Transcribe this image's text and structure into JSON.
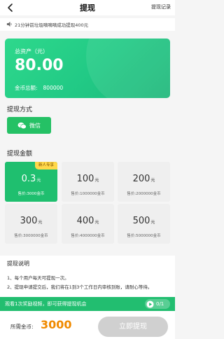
{
  "header": {
    "title": "提现",
    "record_link": "提现记录"
  },
  "notice": {
    "text": "21分钟前垃圾嘀嘀嘀成功提现400元"
  },
  "asset_card": {
    "label": "总资产（元）",
    "value": "80.00",
    "coin_label": "金币总额:",
    "coin_value": "800000"
  },
  "method": {
    "title": "提现方式",
    "wechat_label": "微信"
  },
  "amount": {
    "title": "提现金额",
    "options": [
      {
        "amount": "0.3",
        "unit": "元",
        "price": "售价:3000金币",
        "badge": "新人专享",
        "selected": true
      },
      {
        "amount": "100",
        "unit": "元",
        "price": "售价:1000000金币",
        "badge": "",
        "selected": false
      },
      {
        "amount": "200",
        "unit": "元",
        "price": "售价:2000000金币",
        "badge": "",
        "selected": false
      },
      {
        "amount": "300",
        "unit": "元",
        "price": "售价:3000000金币",
        "badge": "",
        "selected": false
      },
      {
        "amount": "400",
        "unit": "元",
        "price": "售价:4000000金币",
        "badge": "",
        "selected": false
      },
      {
        "amount": "500",
        "unit": "元",
        "price": "售价:5000000金币",
        "badge": "",
        "selected": false
      }
    ]
  },
  "explanation": {
    "title": "提现说明",
    "rules": [
      "1、每个用户每天可提现一次。",
      "2、提现申请提交后，我们将在1到3个工作日内审核到账，请耐心等待。"
    ]
  },
  "video_bar": {
    "text": "观看1次奖励视频，即可获得提现机会",
    "progress": "0/1"
  },
  "bottom": {
    "need_label": "所需金币:",
    "need_value": "3000",
    "withdraw_label": "立即提现"
  },
  "colors": {
    "accent_green": "#22be70",
    "coin_orange": "#f08a00",
    "badge_yellow": "#ffd84a",
    "disabled_gray": "#d0d0d0"
  }
}
